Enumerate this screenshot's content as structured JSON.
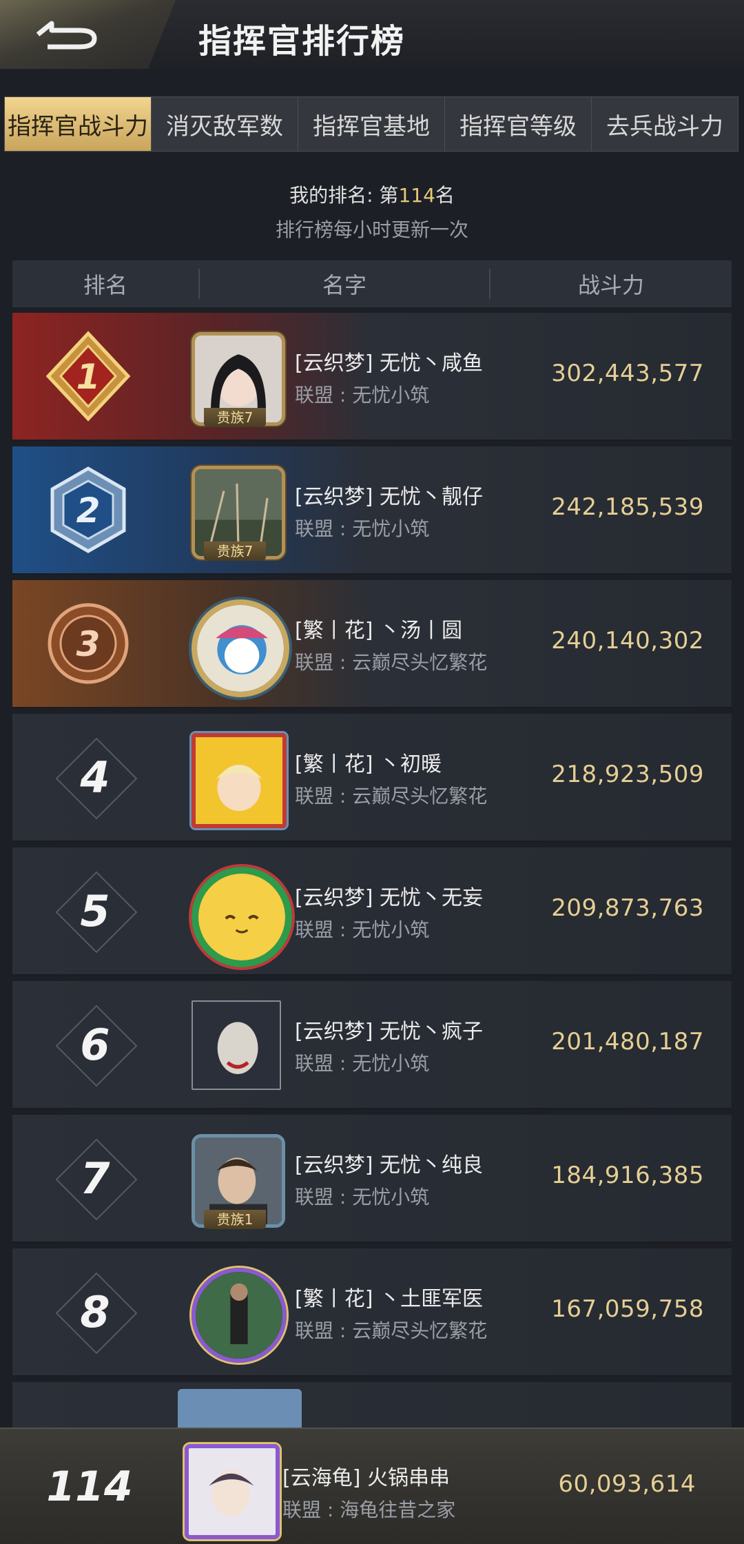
{
  "header": {
    "title": "指挥官排行榜"
  },
  "tabs": [
    {
      "label": "指挥官战斗力",
      "active": true
    },
    {
      "label": "消灭敌军数",
      "active": false
    },
    {
      "label": "指挥官基地",
      "active": false
    },
    {
      "label": "指挥官等级",
      "active": false
    },
    {
      "label": "去兵战斗力",
      "active": false
    }
  ],
  "my_rank": {
    "prefix": "我的排名: 第",
    "value": "114",
    "suffix": "名"
  },
  "update_note": "排行榜每小时更新一次",
  "columns": {
    "rank": "排名",
    "name": "名字",
    "power": "战斗力"
  },
  "rows": [
    {
      "rank": "1",
      "name": "[云织梦] 无忧丶咸鱼",
      "alliance": "联盟 : 无忧小筑",
      "power": "302,443,577",
      "title": "贵族7"
    },
    {
      "rank": "2",
      "name": "[云织梦] 无忧丶靓仔",
      "alliance": "联盟 : 无忧小筑",
      "power": "242,185,539",
      "title": "贵族7"
    },
    {
      "rank": "3",
      "name": "[繁丨花] 丶汤丨圆",
      "alliance": "联盟 : 云巅尽头忆繁花",
      "power": "240,140,302"
    },
    {
      "rank": "4",
      "name": "[繁丨花] 丶初暖",
      "alliance": "联盟 : 云巅尽头忆繁花",
      "power": "218,923,509"
    },
    {
      "rank": "5",
      "name": "[云织梦] 无忧丶无妄",
      "alliance": "联盟 : 无忧小筑",
      "power": "209,873,763"
    },
    {
      "rank": "6",
      "name": "[云织梦] 无忧丶疯子",
      "alliance": "联盟 : 无忧小筑",
      "power": "201,480,187"
    },
    {
      "rank": "7",
      "name": "[云织梦] 无忧丶纯良",
      "alliance": "联盟 : 无忧小筑",
      "power": "184,916,385",
      "title": "贵族1"
    },
    {
      "rank": "8",
      "name": "[繁丨花] 丶土匪军医",
      "alliance": "联盟 : 云巅尽头忆繁花",
      "power": "167,059,758"
    }
  ],
  "me": {
    "rank": "114",
    "name": "[云海龟] 火锅串串",
    "alliance": "联盟 : 海龟往昔之家",
    "power": "60,093,614"
  },
  "colors": {
    "gold_text": "#e6cf95",
    "tab_active": "#f1d58f",
    "rank1": "#8d2422",
    "rank2": "#1f4f86",
    "rank3": "#7a4624"
  }
}
